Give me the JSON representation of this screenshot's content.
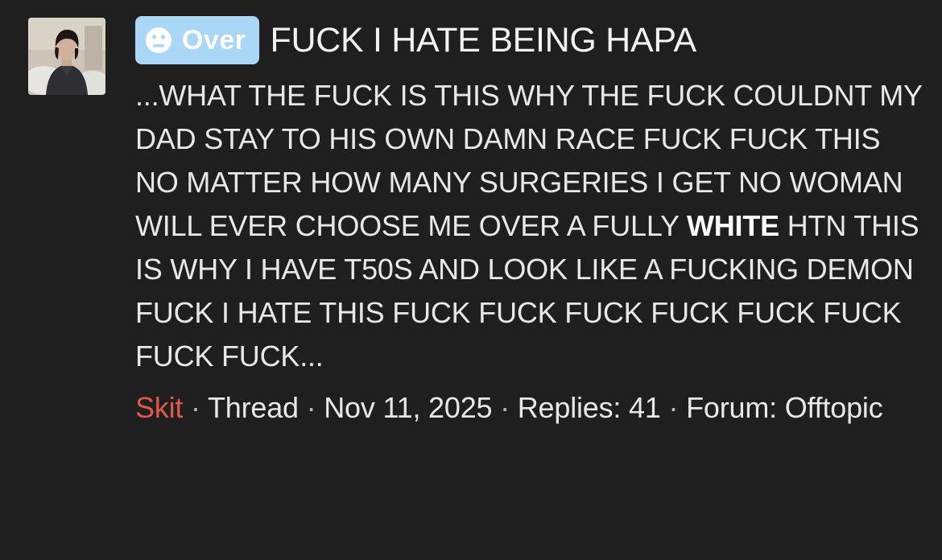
{
  "thread": {
    "prefix_label": "Over",
    "prefix_icon": "sad-face-icon",
    "title": "FUCK I HATE BEING HAPA",
    "snippet": {
      "part1": "...WHAT THE FUCK IS THIS WHY THE FUCK COULDNT MY DAD STAY TO HIS OWN DAMN RACE FUCK FUCK THIS NO MATTER HOW MANY SURGERIES I GET NO WOMAN WILL EVER CHOOSE ME OVER A FULLY ",
      "highlight": "WHITE",
      "part2": " HTN THIS IS WHY I HAVE T50S AND LOOK LIKE A FUCKING DEMON FUCK I HATE THIS FUCK FUCK FUCK FUCK FUCK FUCK FUCK FUCK..."
    },
    "meta": {
      "author": "Skit",
      "separator": " · ",
      "type": "Thread",
      "date": "Nov 11, 2025",
      "replies_label": "Replies:",
      "replies_count": "41",
      "forum_label": "Forum:",
      "forum_name": "Offtopic"
    }
  },
  "colors": {
    "background": "#1f1f1f",
    "badge_bg": "#a9d7f5",
    "author": "#e0584a",
    "text": "#e8e8e8"
  }
}
